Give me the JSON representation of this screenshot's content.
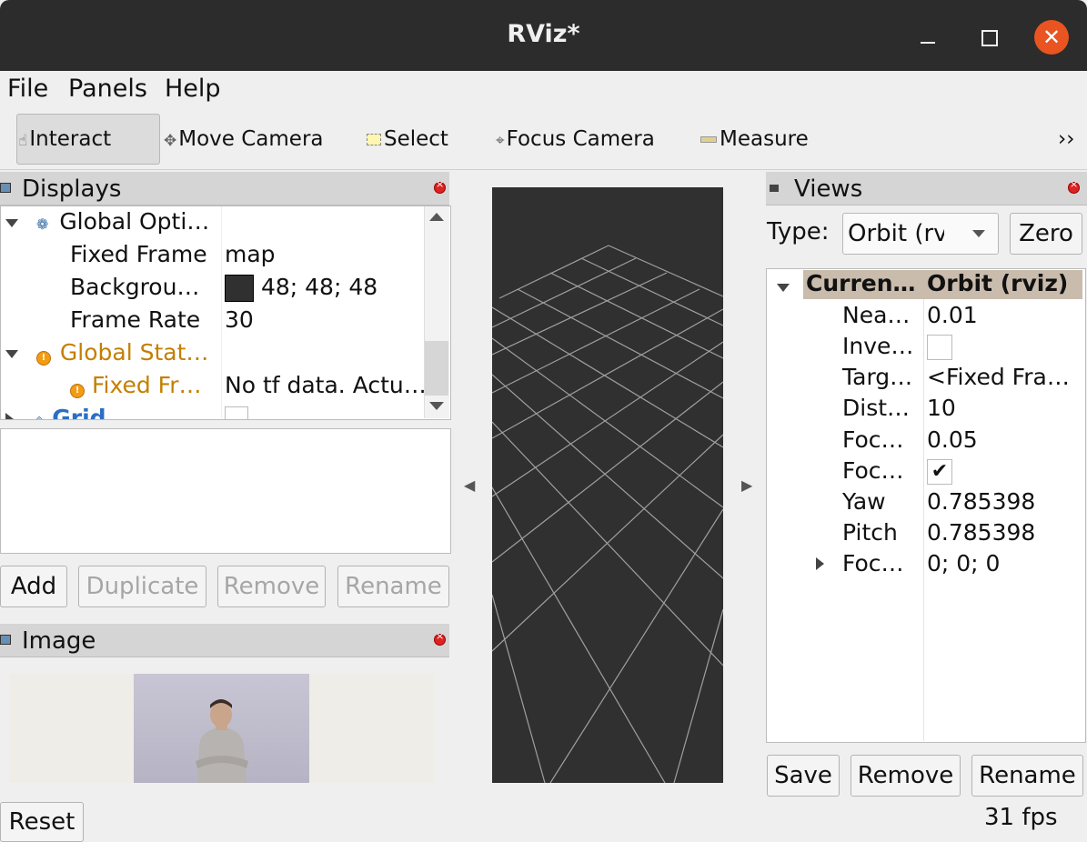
{
  "window": {
    "title": "RViz*"
  },
  "menu": {
    "file": "File",
    "panels": "Panels",
    "help": "Help"
  },
  "toolbar": {
    "interact": "Interact",
    "move_camera": "Move Camera",
    "select": "Select",
    "focus_camera": "Focus Camera",
    "measure": "Measure",
    "overflow": "››"
  },
  "displays": {
    "title": "Displays",
    "rows": [
      {
        "label": "Global Opti…",
        "value": ""
      },
      {
        "label": "Fixed Frame",
        "value": "map"
      },
      {
        "label": "Backgrou…",
        "value": "48; 48; 48",
        "swatch": "#303030"
      },
      {
        "label": "Frame Rate",
        "value": "30"
      },
      {
        "label": "Global Stat…",
        "value": ""
      },
      {
        "label": "Fixed Fr…",
        "value": "No tf data.  Actu…"
      },
      {
        "label": "Grid",
        "value": ""
      }
    ],
    "buttons": {
      "add": "Add",
      "duplicate": "Duplicate",
      "remove": "Remove",
      "rename": "Rename"
    }
  },
  "image_panel": {
    "title": "Image",
    "reset": "Reset"
  },
  "views": {
    "title": "Views",
    "type_label": "Type:",
    "type_value": "Orbit (rviz",
    "zero": "Zero",
    "header": {
      "label": "Curren…",
      "value": "Orbit (rviz)"
    },
    "rows": [
      {
        "label": "Nea…",
        "value": "0.01"
      },
      {
        "label": "Inve…",
        "value": ""
      },
      {
        "label": "Targ…",
        "value": "<Fixed Fra…"
      },
      {
        "label": "Dist…",
        "value": "10"
      },
      {
        "label": "Foc…",
        "value": "0.05"
      },
      {
        "label": "Foc…",
        "value": ""
      },
      {
        "label": "Yaw",
        "value": "0.785398"
      },
      {
        "label": "Pitch",
        "value": "0.785398"
      },
      {
        "label": "Foc…",
        "value": "0; 0; 0"
      }
    ],
    "buttons": {
      "save": "Save",
      "remove": "Remove",
      "rename": "Rename"
    }
  },
  "status": {
    "fps": "31 fps"
  },
  "colors": {
    "background": "#303030",
    "grid": "#a0a0a0",
    "accent_close": "#e95420",
    "warning": "#f39c12"
  }
}
